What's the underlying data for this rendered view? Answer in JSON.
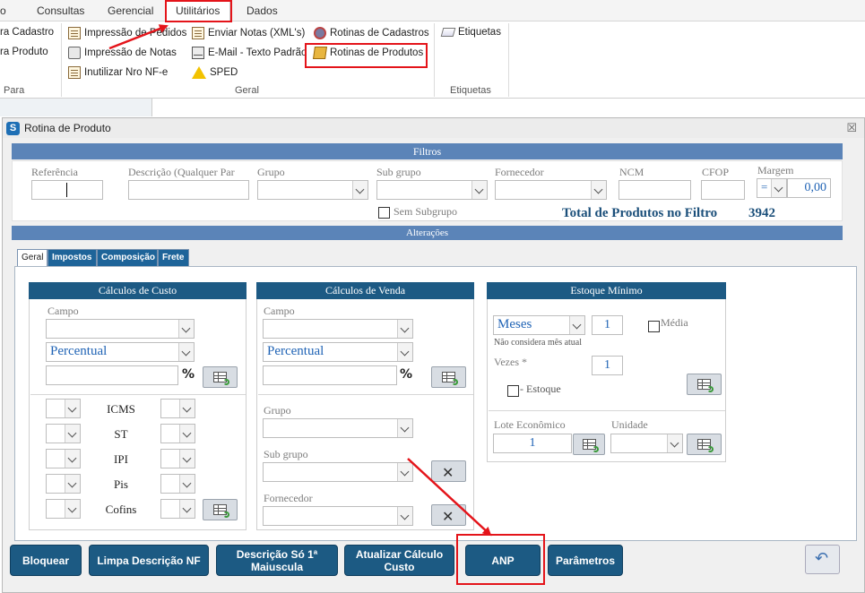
{
  "ribbon": {
    "menu": [
      "o",
      "Consultas",
      "Gerencial",
      "Utilitários",
      "Dados"
    ],
    "active_tab": "Utilitários",
    "col1": [
      "ra Cadastro",
      "ra Produto"
    ],
    "col2": [
      "Impressão de Pedidos",
      "Impressão de Notas",
      "Inutilizar Nro NF-e"
    ],
    "col3": [
      "Enviar Notas (XML's)",
      "E-Mail - Texto Padrão",
      "SPED"
    ],
    "col4": [
      "Rotinas de Cadastros",
      "Rotinas de Produtos"
    ],
    "col5": [
      "Etiquetas"
    ],
    "groups": {
      "para": "Para",
      "geral": "Geral",
      "etiquetas": "Etiquetas"
    }
  },
  "window": {
    "title": "Rotina de Produto",
    "close": "☒"
  },
  "filtros": {
    "header": "Filtros",
    "labels": {
      "referencia": "Referência",
      "descricao": "Descrição (Qualquer Par",
      "grupo": "Grupo",
      "subgrupo": "Sub grupo",
      "fornecedor": "Fornecedor",
      "ncm": "NCM",
      "cfop": "CFOP",
      "margem": "Margem"
    },
    "margem_operator": "=",
    "margem_value": "0,00",
    "sem_subgrupo": "Sem Subgrupo",
    "total_label": "Total de Produtos no Filtro",
    "total_value": "3942"
  },
  "alteracoes": {
    "header": "Alterações"
  },
  "tabs": [
    "Geral",
    "Impostos",
    "Composição",
    "Frete"
  ],
  "custo": {
    "header": "Cálculos de Custo",
    "campo_label": "Campo",
    "tipo": "Percentual",
    "pct": "%",
    "impostos": [
      "ICMS",
      "ST",
      "IPI",
      "Pis",
      "Cofins"
    ]
  },
  "venda": {
    "header": "Cálculos de Venda",
    "campo_label": "Campo",
    "tipo": "Percentual",
    "pct": "%",
    "grupo_label": "Grupo",
    "subgrupo_label": "Sub grupo",
    "fornecedor_label": "Fornecedor"
  },
  "estoque": {
    "header": "Estoque Mínimo",
    "periodo": "Meses",
    "periodo_qtd": "1",
    "media_label": "Média",
    "nao_considera": "Não considera mês atual",
    "vezes_label": "Vezes *",
    "vezes_value": "1",
    "estoque_label": "- Estoque",
    "lote_label": "Lote Econômico",
    "lote_value": "1",
    "unidade_label": "Unidade"
  },
  "buttons": {
    "bloquear": "Bloquear",
    "limpa": "Limpa Descrição NF",
    "descricao1": "Descrição Só 1ª",
    "descricao2": "Maiuscula",
    "atualizar1": "Atualizar Cálculo",
    "atualizar2": "Custo",
    "anp": "ANP",
    "parametros": "Parâmetros",
    "back": "↶"
  },
  "colors": {
    "section_blue": "#5b84b8",
    "header_dark": "#1d5a84",
    "button": "#1c5a83",
    "highlight_red": "#e4141a",
    "value_blue": "#1f63b5"
  }
}
